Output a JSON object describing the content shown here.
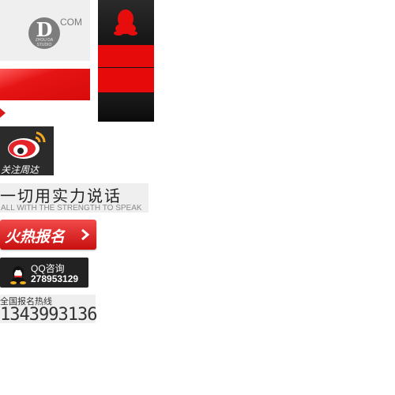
{
  "logo": {
    "mark": "D",
    "ring_text": "ZHOU DA STUDIO",
    "suffix": "COM"
  },
  "weibo": {
    "label": "关注周达",
    "icon": "weibo-icon"
  },
  "slogan": {
    "cn": "一切用实力说话",
    "en": "ALL WITH THE STRENGTH TO SPEAK"
  },
  "register": {
    "label": "火热报名",
    "icon": "chevron-right-icon"
  },
  "qq": {
    "label": "QQ咨询",
    "number": "278953129",
    "icon": "qq-penguin-icon"
  },
  "hotline": {
    "label": "全国报名热线",
    "number": "1343993136"
  },
  "colors": {
    "accent_red": "#e60a0a",
    "dark": "#141414",
    "light_gray": "#efefef"
  }
}
